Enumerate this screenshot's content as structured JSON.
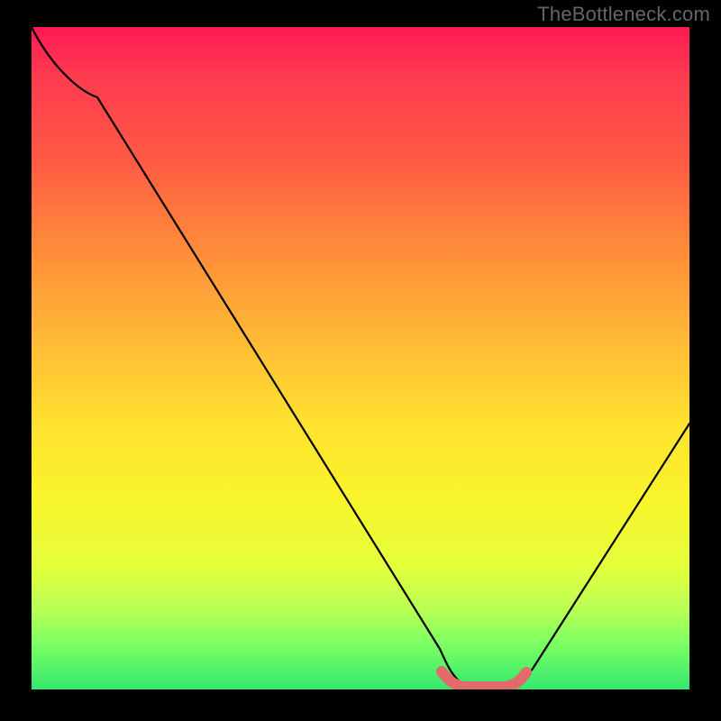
{
  "watermark": "TheBottleneck.com",
  "chart_data": {
    "type": "line",
    "title": "",
    "xlabel": "",
    "ylabel": "",
    "xlim": [
      0,
      100
    ],
    "ylim": [
      0,
      100
    ],
    "grid": false,
    "legend": false,
    "series": [
      {
        "name": "bottleneck-curve",
        "x": [
          0,
          5,
          10,
          20,
          30,
          40,
          50,
          60,
          62,
          66,
          70,
          72,
          75,
          80,
          85,
          90,
          95,
          100
        ],
        "y": [
          100,
          94,
          90,
          77,
          63,
          49,
          35,
          14,
          6,
          1,
          0,
          0,
          0,
          1,
          7,
          18,
          29,
          41
        ]
      }
    ],
    "optimal_zone": {
      "comment": "highlighted pink segment near minimum",
      "x_start": 62,
      "x_end": 75,
      "y": 0
    },
    "background_gradient": {
      "top": "#ff1a53",
      "mid": "#ffe22f",
      "bottom": "#33e86e"
    }
  }
}
